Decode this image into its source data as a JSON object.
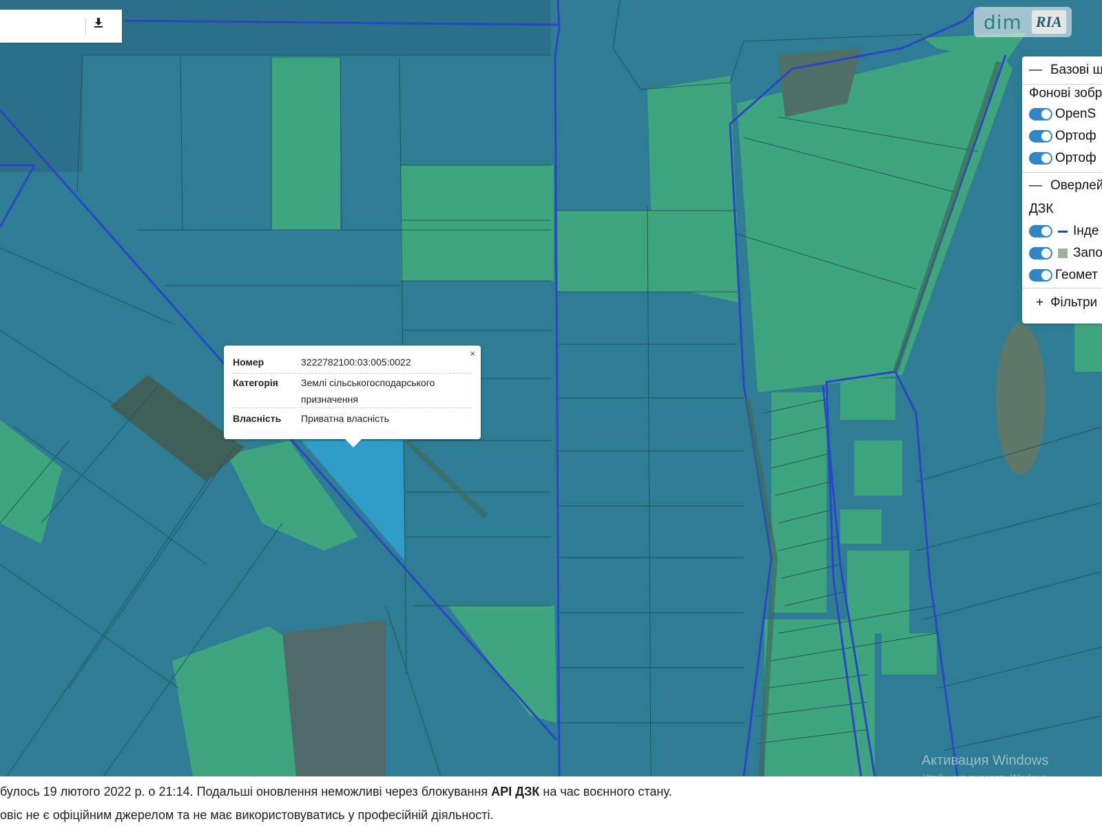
{
  "toolbar": {
    "download_icon": "download-icon"
  },
  "logo": {
    "brand": "dim",
    "partner": "RIA"
  },
  "layers_panel": {
    "base_group": "Базові ш",
    "background_title": "Фонові зобр",
    "background_items": [
      "OpenS",
      "Ортоф",
      "Ортоф"
    ],
    "overlay_group": "Оверлей",
    "dzk_title": "ДЗК",
    "dzk_items": [
      "Інде",
      "Запо",
      "Геомет"
    ],
    "filters": "Фільтри"
  },
  "popup": {
    "close": "×",
    "number_label": "Номер",
    "number_value": "3222782100:03:005:0022",
    "category_label": "Категорія",
    "category_value": "Землі сільськогосподарського призначення",
    "ownership_label": "Власність",
    "ownership_value": "Приватна власність"
  },
  "footer": {
    "line1_pre": "булось 19 лютого 2022 р. о 21:14. Подальші оновлення неможливі через блокування ",
    "line1_bold": "API ДЗК",
    "line1_post": " на час воєнного стану.",
    "line2": "овіс не є офіційним джерелом та не має використовуватись у професійній діяльності."
  },
  "watermark": {
    "title": "Активация Windows",
    "subtitle": "Чтобы активировать Windows,"
  },
  "colors": {
    "parcel_blue": "#2f7d94",
    "parcel_green": "#3ea57e",
    "selected_parcel": "#2f9dc8",
    "boundary_line": "#2a45c8",
    "toggle_on": "#2f86c6"
  }
}
